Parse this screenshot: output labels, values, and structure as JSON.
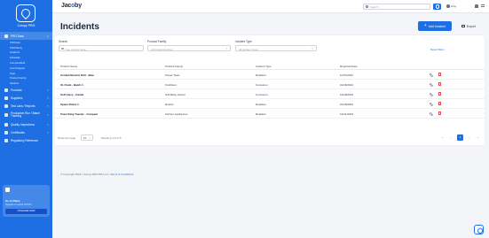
{
  "sidebar": {
    "brand": "Compy PRO",
    "items": [
      {
        "label": "PRO Data",
        "active": true
      },
      {
        "label": "PRO/Jam",
        "sub": true
      },
      {
        "label": "PRO/Study",
        "sub": true
      },
      {
        "label": "Incidents",
        "sub": true
      },
      {
        "label": "Schedule",
        "sub": true
      },
      {
        "label": "Compare/Edit",
        "sub": true
      },
      {
        "label": "Cost Analysis",
        "sub": true
      },
      {
        "label": "Tags",
        "sub": true
      },
      {
        "label": "Product Family",
        "sub": true
      },
      {
        "label": "Variants",
        "sub": true
      },
      {
        "label": "Products"
      },
      {
        "label": "Suppliers"
      },
      {
        "label": "Test Labs / Reports"
      },
      {
        "label": "Production Run / Batch Tracking"
      },
      {
        "label": "Quality Inspections"
      },
      {
        "label": "Certificates"
      },
      {
        "label": "Regulatory Reference"
      }
    ],
    "upgrade": {
      "title": "Go to Plans",
      "subtitle": "Upgrade to unlock all PRO",
      "button": "UPGRADE NOW"
    }
  },
  "topbar": {
    "logo_main": "Jac",
    "logo_dot": "o",
    "logo_end": "by",
    "search_placeholder": "Search",
    "user_name": "Amy"
  },
  "page": {
    "title": "Incidents",
    "add_label": "Add Incident",
    "export_label": "Export"
  },
  "filters": {
    "search_label": "Search",
    "search_placeholder": "Type product name",
    "family_label": "Product Family",
    "family_value": "All Product Families",
    "type_label": "Incident Type",
    "type_value": "All Incident Types",
    "reset": "Reset Filters"
  },
  "table": {
    "headers": [
      "Product Name",
      "Product Family",
      "Incident Type",
      "Reported Date"
    ],
    "rows": [
      {
        "name": "Corded Electric Drill - Blue",
        "family": "Power Tools",
        "type": "Retailers",
        "date": "11/07/2023"
      },
      {
        "name": "XL Knob - Batch 1",
        "family": "Knobbers",
        "type": "Consumer",
        "date": "01/18/2024"
      },
      {
        "name": "Soft Carry - Camel",
        "family": "Soft Baby Carrier",
        "type": "Consumer",
        "date": "10/18/2023"
      },
      {
        "name": "Space Robot 1",
        "family": "Robots",
        "type": "Retailers",
        "date": "01/18/2024"
      },
      {
        "name": "Toast King Toaster - Compact",
        "family": "Kitchen Appliances",
        "type": "Retailers",
        "date": "12/21/2023"
      }
    ]
  },
  "pagination": {
    "rows_label": "Rows per page",
    "rows_value": "10",
    "showing": "Showing 1-5 of 5",
    "pages": [
      "«",
      "‹",
      "1",
      "›",
      "»"
    ]
  },
  "footer": {
    "text": "© Copyright 2024 | Compy PRO BS LLC | ",
    "link": "Terms & Conditions"
  },
  "colors": {
    "primary": "#1d6fe3",
    "danger": "#ef4444"
  }
}
